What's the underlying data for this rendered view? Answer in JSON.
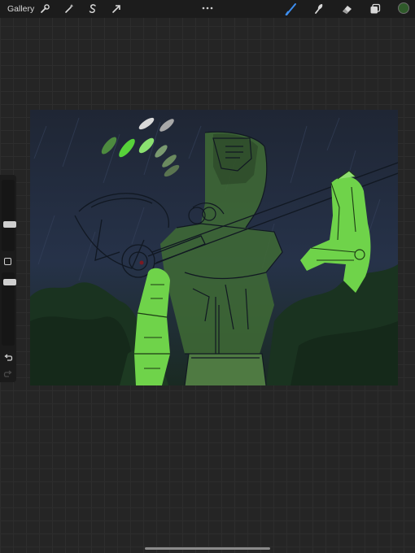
{
  "topbar": {
    "gallery_label": "Gallery",
    "left_tools": [
      "wrench-icon",
      "magic-wand-icon",
      "selection-s-icon",
      "transform-arrow-icon"
    ],
    "right_tools": [
      "brush-icon",
      "smudge-icon",
      "eraser-icon",
      "layers-icon"
    ],
    "active_tool": "brush",
    "active_color": "#2f5a2a"
  },
  "sidebar": {
    "brush_size_level": 0.35,
    "opacity_level": 0.5,
    "undo_enabled": true,
    "redo_enabled": false
  },
  "canvas": {
    "background_color": "#20283a",
    "accent_green": "#6fd34a"
  }
}
